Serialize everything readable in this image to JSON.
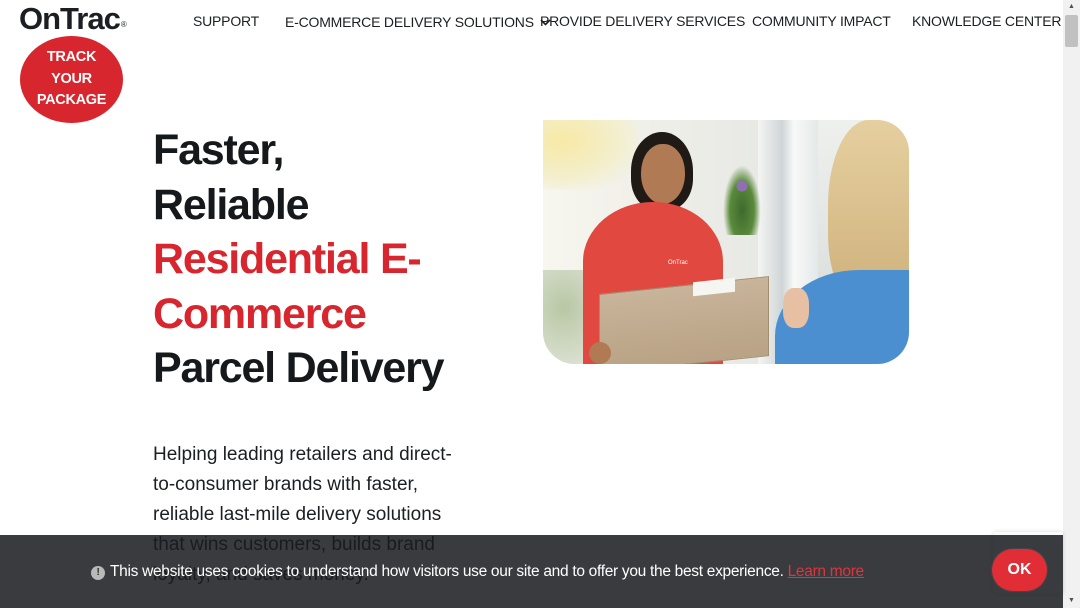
{
  "brand": {
    "logo_text": "OnTrac",
    "logo_mark": "®"
  },
  "track": {
    "line1": "TRACK",
    "line2": "YOUR",
    "line3": "PACKAGE"
  },
  "nav": {
    "support": "SUPPORT",
    "ecommerce": "E-COMMERCE DELIVERY SOLUTIONS",
    "provide": "PROVIDE DELIVERY SERVICES",
    "community": "COMMUNITY IMPACT",
    "knowledge": "KNOWLEDGE CENTER"
  },
  "hero": {
    "line1": "Faster,",
    "line2": "Reliable",
    "line3": "Residential E-",
    "line4": "Commerce",
    "line5": "Parcel Delivery",
    "subtitle": "Helping leading retailers and direct-to-consumer brands with faster, reliable last-mile delivery solutions that wins customers, builds brand loyalty, and saves money."
  },
  "photo": {
    "shirt_logo": "OnTrac"
  },
  "cookie": {
    "text": "This website uses cookies to understand how visitors use our site and to offer you the best experience.",
    "learn_more": "Learn more",
    "ok": "OK",
    "info_icon": "!"
  },
  "scrollbar": {
    "up": "▲",
    "down": "▼"
  },
  "colors": {
    "brand_red": "#d7262e",
    "dark_text": "#15191c",
    "banner": "#191b1e"
  }
}
